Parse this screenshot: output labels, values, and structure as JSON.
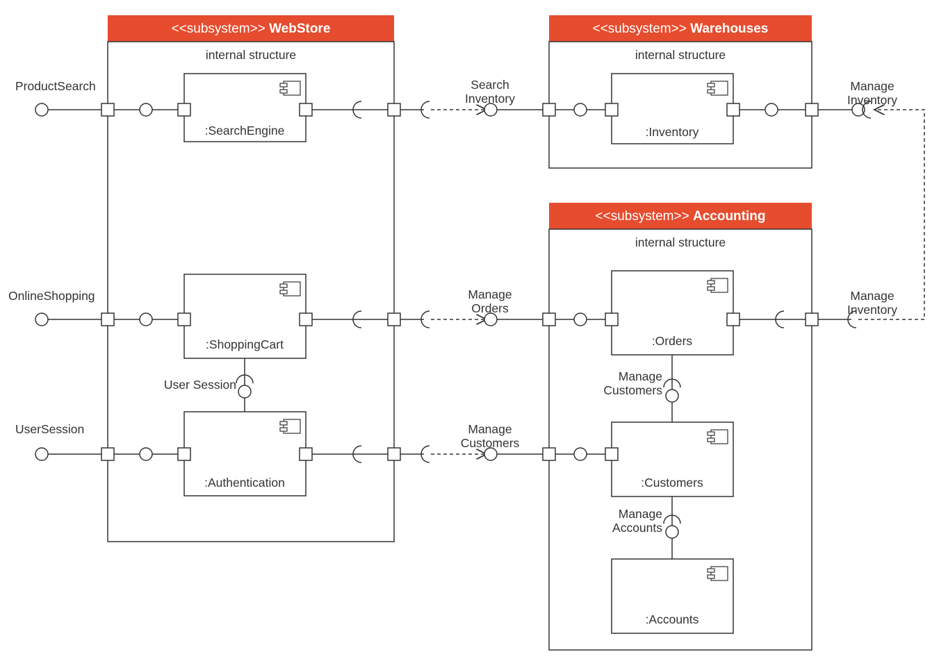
{
  "stereotype": "<<subsystem>>",
  "internal_structure": "internal structure",
  "subsystems": {
    "webstore": "WebStore",
    "warehouses": "Warehouses",
    "accounting": "Accounting"
  },
  "components": {
    "searchengine": ":SearchEngine",
    "shoppingcart": ":ShoppingCart",
    "authentication": ":Authentication",
    "inventory": ":Inventory",
    "orders": ":Orders",
    "customers": ":Customers",
    "accounts": ":Accounts"
  },
  "interfaces": {
    "productsearch": "ProductSearch",
    "onlineshopping": "OnlineShopping",
    "usersession": "UserSession",
    "searchinventory": "Search\nInventory",
    "manageorders": "Manage\nOrders",
    "managecustomers": "Manage\nCustomers",
    "usersessioninterface": "User Session",
    "managecustomers2": "Manage\nCustomers",
    "manageaccounts": "Manage\nAccounts",
    "manageinventory": "Manage\nInventory",
    "manageinventory2": "Manage\nInventory"
  }
}
